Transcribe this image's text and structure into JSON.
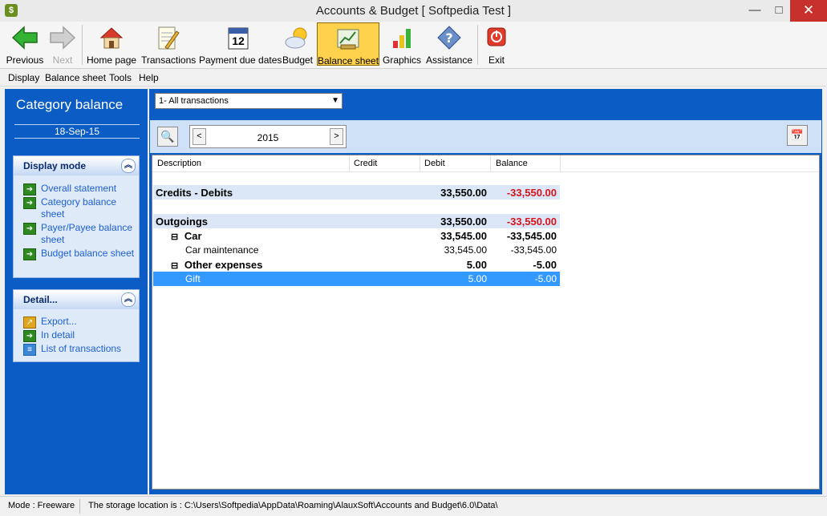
{
  "window": {
    "title": "Accounts & Budget [ Softpedia Test ]",
    "app_icon": "$",
    "minimize": "—",
    "maximize": "□",
    "close": "✕"
  },
  "toolbar": {
    "previous": "Previous",
    "next": "Next",
    "home": "Home page",
    "transactions": "Transactions",
    "payment_due": "Payment due dates",
    "payment_due_day": "12",
    "budget": "Budget",
    "balance_sheet": "Balance sheet",
    "graphics": "Graphics",
    "assistance": "Assistance",
    "exit": "Exit"
  },
  "menu": {
    "display": "Display",
    "balance_sheet": "Balance sheet",
    "tools": "Tools",
    "help": "Help"
  },
  "left_panel": {
    "title": "Category balance",
    "date": "18-Sep-15",
    "display_mode": {
      "title": "Display mode",
      "items": [
        "Overall statement",
        "Category balance sheet",
        "Payer/Payee balance sheet",
        "Budget balance sheet"
      ]
    },
    "detail": {
      "title": "Detail...",
      "items": [
        "Export...",
        "In detail",
        "List of transactions"
      ]
    }
  },
  "main": {
    "filter_value": "1- All transactions",
    "year": "2015",
    "prev_year": "<",
    "next_year": ">",
    "columns": [
      "Description",
      "Credit",
      "Debit",
      "Balance"
    ],
    "rows": [
      {
        "description": "Credits - Debits",
        "credit": "",
        "debit": "33,550.00",
        "balance": "-33,550.00"
      },
      {
        "description": "Outgoings",
        "credit": "",
        "debit": "33,550.00",
        "balance": "-33,550.00"
      },
      {
        "description": "Car",
        "toggle": "⊟",
        "credit": "",
        "debit": "33,545.00",
        "balance": "-33,545.00"
      },
      {
        "description": "Car maintenance",
        "credit": "",
        "debit": "33,545.00",
        "balance": "-33,545.00"
      },
      {
        "description": "Other expenses",
        "toggle": "⊟",
        "credit": "",
        "debit": "5.00",
        "balance": "-5.00"
      },
      {
        "description": "Gift",
        "credit": "",
        "debit": "5.00",
        "balance": "-5.00"
      }
    ]
  },
  "status": {
    "mode": "Mode : Freeware",
    "path": "The storage location is : C:\\Users\\Softpedia\\AppData\\Roaming\\AlauxSoft\\Accounts and Budget\\6.0\\Data\\"
  },
  "colors": {
    "panel_blue": "#0b5cc4",
    "selection": "#3399ff",
    "negative": "#d8141a",
    "active_tool": "#ffd24d"
  }
}
